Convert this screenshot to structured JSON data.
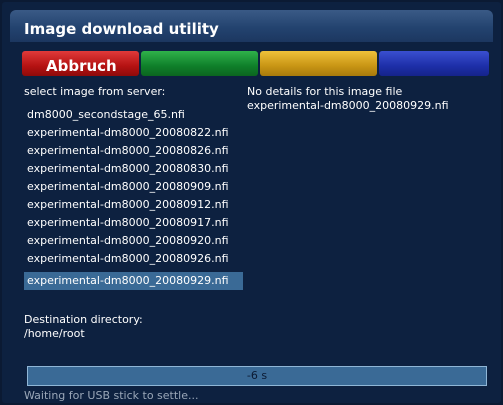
{
  "window": {
    "title": "Image download utility"
  },
  "buttons": {
    "red_label": "Abbruch",
    "green_label": "",
    "yellow_label": "",
    "blue_label": ""
  },
  "left_panel": {
    "header": "select image from server:",
    "items": [
      "dm8000_secondstage_65.nfi",
      "experimental-dm8000_20080822.nfi",
      "experimental-dm8000_20080826.nfi",
      "experimental-dm8000_20080830.nfi",
      "experimental-dm8000_20080909.nfi",
      "experimental-dm8000_20080912.nfi",
      "experimental-dm8000_20080917.nfi",
      "experimental-dm8000_20080920.nfi",
      "experimental-dm8000_20080926.nfi",
      "experimental-dm8000_20080929.nfi"
    ],
    "selected_index": 9
  },
  "right_panel": {
    "details_line1": "No details for this image file",
    "details_line2": "experimental-dm8000_20080929.nfi"
  },
  "destination": {
    "label": "Destination directory:",
    "path": "/home/root"
  },
  "progress": {
    "text": "-6 s"
  },
  "status": {
    "text": "Waiting for USB stick to settle..."
  }
}
